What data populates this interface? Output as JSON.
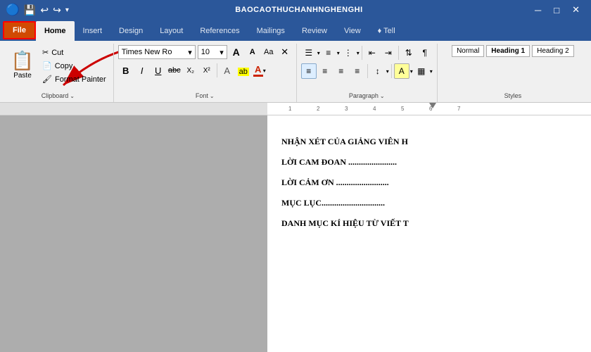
{
  "title_bar": {
    "title": "BAOCAOTHUCHANHNGHENGHI",
    "save_icon": "💾",
    "undo_icon": "↩",
    "redo_icon": "↪",
    "quick_access_icon": "▾"
  },
  "ribbon_tabs": {
    "tabs": [
      {
        "id": "file",
        "label": "File",
        "active": false,
        "is_file": true
      },
      {
        "id": "home",
        "label": "Home",
        "active": true
      },
      {
        "id": "insert",
        "label": "Insert",
        "active": false
      },
      {
        "id": "design",
        "label": "Design",
        "active": false
      },
      {
        "id": "layout",
        "label": "Layout",
        "active": false
      },
      {
        "id": "references",
        "label": "References",
        "active": false
      },
      {
        "id": "mailings",
        "label": "Mailings",
        "active": false
      },
      {
        "id": "review",
        "label": "Review",
        "active": false
      },
      {
        "id": "view",
        "label": "View",
        "active": false
      },
      {
        "id": "tell",
        "label": "♦ Tell",
        "active": false
      }
    ]
  },
  "clipboard": {
    "group_label": "Clipboard",
    "paste_label": "Paste",
    "cut_label": "Cut",
    "copy_label": "Copy",
    "format_painter_label": "Format Painter"
  },
  "font": {
    "group_label": "Font",
    "font_name": "Times New Ro",
    "font_size": "10",
    "grow_label": "A",
    "shrink_label": "A",
    "clear_label": "✕",
    "bold": "B",
    "italic": "I",
    "underline": "U",
    "strikethrough": "abc",
    "subscript": "X₂",
    "superscript": "X²",
    "text_effects": "A",
    "highlight": "ab",
    "font_color": "A"
  },
  "paragraph": {
    "group_label": "Paragraph",
    "show_dialog": "⌄"
  },
  "document": {
    "lines": [
      "NHẬN XÉT CỦA GIẢNG VIÊN H",
      "LỜI CAM ĐOAN .......................",
      "LỜI CẢM ƠN .........................",
      "MỤC LỤC..............................",
      "DANH MỤC KÍ HIỆU TỪ VIẾT T"
    ]
  }
}
